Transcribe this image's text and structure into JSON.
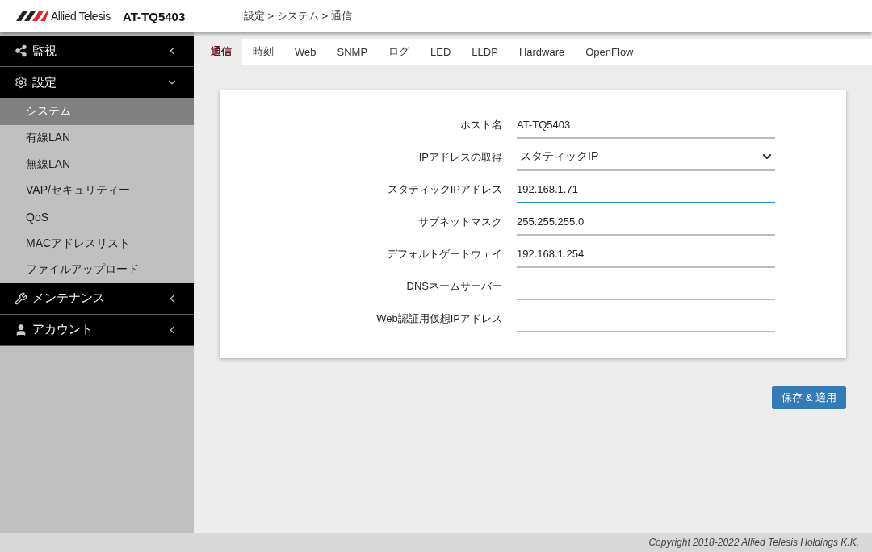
{
  "header": {
    "logo_text": "Allied Telesis",
    "model": "AT-TQ5403",
    "breadcrumb": "設定 > システム > 通信"
  },
  "sidebar": {
    "sections": [
      {
        "label": "監視",
        "expanded": false
      },
      {
        "label": "設定",
        "expanded": true,
        "children": [
          {
            "label": "システム",
            "selected": true
          },
          {
            "label": "有線LAN",
            "selected": false
          },
          {
            "label": "無線LAN",
            "selected": false
          },
          {
            "label": "VAP/セキュリティー",
            "selected": false
          },
          {
            "label": "QoS",
            "selected": false
          },
          {
            "label": "MACアドレスリスト",
            "selected": false
          },
          {
            "label": "ファイルアップロード",
            "selected": false
          }
        ]
      },
      {
        "label": "メンテナンス",
        "expanded": false
      },
      {
        "label": "アカウント",
        "expanded": false
      }
    ]
  },
  "tabs": [
    {
      "label": "通信",
      "selected": true
    },
    {
      "label": "時刻",
      "selected": false
    },
    {
      "label": "Web",
      "selected": false
    },
    {
      "label": "SNMP",
      "selected": false
    },
    {
      "label": "ログ",
      "selected": false
    },
    {
      "label": "LED",
      "selected": false
    },
    {
      "label": "LLDP",
      "selected": false
    },
    {
      "label": "Hardware",
      "selected": false
    },
    {
      "label": "OpenFlow",
      "selected": false
    }
  ],
  "form": {
    "fields": [
      {
        "label": "ホスト名",
        "kind": "text",
        "value": "AT-TQ5403",
        "focused": false
      },
      {
        "label": "IPアドレスの取得",
        "kind": "select",
        "value": "スタティックIP",
        "focused": false
      },
      {
        "label": "スタティックIPアドレス",
        "kind": "text",
        "value": "192.168.1.71",
        "focused": true
      },
      {
        "label": "サブネットマスク",
        "kind": "text",
        "value": "255.255.255.0",
        "focused": false
      },
      {
        "label": "デフォルトゲートウェイ",
        "kind": "text",
        "value": "192.168.1.254",
        "focused": false
      },
      {
        "label": "DNSネームサーバー",
        "kind": "text",
        "focused": false
      },
      {
        "label": "Web認証用仮想IPアドレス",
        "kind": "text",
        "focused": false
      }
    ]
  },
  "save_button": "保存 & 適用",
  "footer": "Copyright 2018-2022 Allied Telesis Holdings K.K."
}
